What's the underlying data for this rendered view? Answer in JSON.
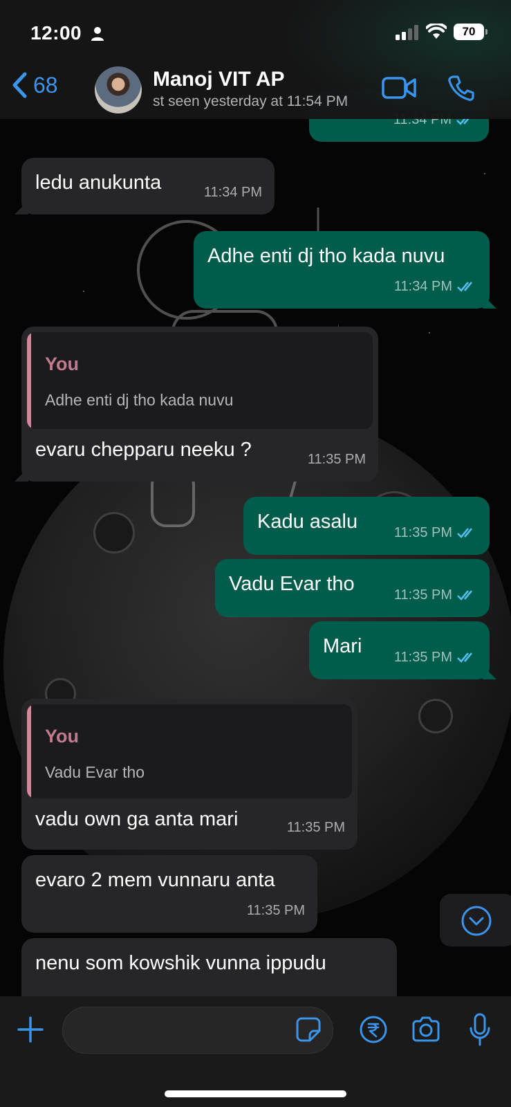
{
  "status": {
    "time": "12:00",
    "battery": "70"
  },
  "header": {
    "back_count": "68",
    "contact_name": "Manoj VIT AP",
    "contact_status": "st seen yesterday at 11:54 PM"
  },
  "messages": [
    {
      "type": "out",
      "text": "",
      "time": "11:34 PM"
    },
    {
      "type": "in",
      "text": "ledu anukunta",
      "time": "11:34 PM"
    },
    {
      "type": "out",
      "text": "Adhe enti dj tho kada nuvu",
      "time": "11:34 PM"
    },
    {
      "type": "in",
      "quote_author": "You",
      "quote_text": "Adhe enti dj tho kada nuvu",
      "text": "evaru chepparu neeku ?",
      "time": "11:35 PM"
    },
    {
      "type": "out",
      "text": "Kadu asalu",
      "time": "11:35 PM"
    },
    {
      "type": "out",
      "text": "Vadu Evar tho",
      "time": "11:35 PM"
    },
    {
      "type": "out",
      "text": "Mari",
      "time": "11:35 PM"
    },
    {
      "type": "in",
      "quote_author": "You",
      "quote_text": "Vadu Evar tho",
      "text": "vadu own ga anta mari",
      "time": "11:35 PM"
    },
    {
      "type": "in",
      "text": "evaro 2 mem vunnaru anta",
      "time": "11:35 PM"
    },
    {
      "type": "in",
      "text": "nenu som kowshik vunna ippudu",
      "time": ""
    }
  ],
  "icons": {
    "back": "chevron-left-icon",
    "video": "video-camera-icon",
    "call": "phone-icon",
    "scroll": "chevron-down-circle-icon",
    "plus": "plus-icon",
    "sticker": "sticker-icon",
    "rupee": "rupee-payment-icon",
    "camera": "camera-icon",
    "mic": "microphone-icon"
  },
  "colors": {
    "accent": "#3b95ec",
    "outgoing": "#005c4b",
    "incoming": "#262628",
    "quote_author": "#c27a8d",
    "read_ticks": "#53bdeb"
  }
}
